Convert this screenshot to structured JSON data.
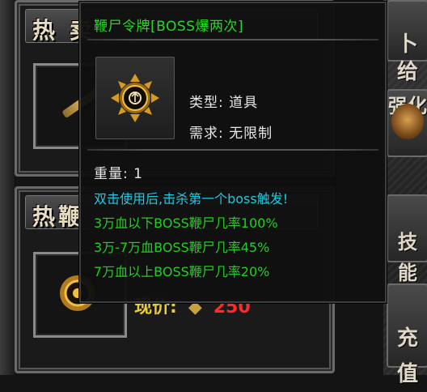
{
  "shop": {
    "panel1_title": "热 卖",
    "panel2_title": "热鞭",
    "price_label": "现价:",
    "price_coin": "◆",
    "price_value": "250"
  },
  "side": {
    "top_label": "卜\n给",
    "mid1_label": "强化",
    "mid2_label": "技\n能",
    "recharge_label": "充\n值"
  },
  "tooltip": {
    "title": "鞭尸令牌[BOSS爆两次]",
    "type": "类型: 道具",
    "requirement": "需求: 无限制",
    "weight": "重量: 1",
    "description": "双击使用后,击杀第一个boss触发!",
    "lines": [
      "3万血以下BOSS鞭尸几率100%",
      "3万-7万血BOSS鞭尸几率45%",
      "7万血以上BOSS鞭尸几率20%"
    ]
  },
  "colors": {
    "title_green": "#24d824",
    "desc_cyan": "#20c8e0",
    "line_green": "#20d020",
    "price_red": "#ff2a2a",
    "price_yellow": "#e8d030"
  },
  "icons": [
    "token-icon",
    "coin-icon",
    "stick-icon",
    "demon-face-icon"
  ]
}
